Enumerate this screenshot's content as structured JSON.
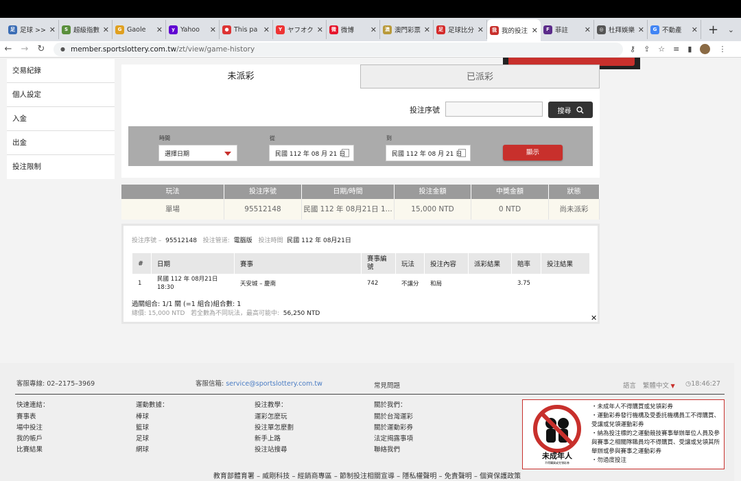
{
  "browser": {
    "tabs": [
      {
        "title": "足球 >>",
        "fav_color": "#3b6db5",
        "fav_text": "足"
      },
      {
        "title": "超級指數",
        "fav_color": "#5a8f3c",
        "fav_text": "S"
      },
      {
        "title": "Gaole",
        "fav_color": "#e0a020",
        "fav_text": "G"
      },
      {
        "title": "Yahoo",
        "fav_color": "#6001d2",
        "fav_text": "y"
      },
      {
        "title": "This pa",
        "fav_color": "#d33",
        "fav_text": "●"
      },
      {
        "title": "ヤフオク",
        "fav_color": "#e33",
        "fav_text": "Y"
      },
      {
        "title": "微博",
        "fav_color": "#e6162d",
        "fav_text": "微"
      },
      {
        "title": "澳門彩票",
        "fav_color": "#b99a3a",
        "fav_text": "澳"
      },
      {
        "title": "足球比分",
        "fav_color": "#d42a2a",
        "fav_text": "足"
      },
      {
        "title": "我的投注",
        "fav_color": "#c8302c",
        "fav_text": "我",
        "active": true
      },
      {
        "title": "菲註",
        "fav_color": "#5b2b8a",
        "fav_text": "F"
      },
      {
        "title": "杜拜娛樂",
        "fav_color": "#555",
        "fav_text": "◎"
      },
      {
        "title": "不動產",
        "fav_color": "#4285f4",
        "fav_text": "G"
      }
    ],
    "url_host": "member.sportslottery.com.tw",
    "url_path": "/zt/view/game-history"
  },
  "sidebar": {
    "items": [
      "交易紀錄",
      "個人設定",
      "入金",
      "出金",
      "投注限制"
    ]
  },
  "tabs": {
    "unsettled": "未派彩",
    "settled": "已派彩"
  },
  "search": {
    "label": "投注序號",
    "value": "",
    "button": "搜尋"
  },
  "filter": {
    "time_label": "時間",
    "time_value": "選擇日期",
    "from_label": "從",
    "from_value": "民國 112 年 08 月 21 日",
    "to_label": "到",
    "to_value": "民國 112 年 08 月 21 日",
    "show_button": "顯示"
  },
  "summary": {
    "headers": [
      "玩法",
      "投注序號",
      "日期/時間",
      "投注金額",
      "中獎金額",
      "狀態"
    ],
    "row": [
      "單場",
      "95512148",
      "民國 112 年 08月21日 1...",
      "15,000 NTD",
      "0 NTD",
      "尚未派彩"
    ]
  },
  "detail": {
    "serial_label": "投注序號 –",
    "serial": "95512148",
    "channel_label": "投注管道:",
    "channel": "電腦版",
    "time_label": "投注時間",
    "time": "民國 112 年 08月21日",
    "headers": [
      "#",
      "日期",
      "賽事",
      "賽事編號",
      "玩法",
      "投注內容",
      "派彩結果",
      "賠率",
      "投注結果"
    ],
    "row": {
      "num": "1",
      "date1": "民國 112 年 08月21日",
      "date2": "18:30",
      "match": "天安城 – 慶南",
      "code": "742",
      "play": "不讓分",
      "content": "和局",
      "result": "",
      "odds": "3.75",
      "bet_result": ""
    },
    "combo": "過關組合: 1/1 關 (=1 組合)組合數: 1",
    "total_label": "總價: 15,000 NTD",
    "total_note": "若全數為不同玩法，最高可能中:",
    "total_max": "56,250 NTD"
  },
  "footer": {
    "hotline": "客服專線: 02–2175–3969",
    "mail_label": "客服信箱:",
    "mail": "service@sportslottery.com.tw",
    "faq": "常見問題",
    "lang_label": "語言",
    "lang": "繁體中文",
    "clock": "18:46:27",
    "cols": [
      {
        "title": "快速連結：",
        "items": [
          "賽事表",
          "場中投注",
          "我的帳戶",
          "比賽結果"
        ]
      },
      {
        "title": "運動數據：",
        "items": [
          "棒球",
          "籃球",
          "足球",
          "網球"
        ]
      },
      {
        "title": "投注教學：",
        "items": [
          "運彩怎麼玩",
          "投注單怎麼劃",
          "新手上路",
          "投注站搜尋"
        ]
      },
      {
        "title": "關於我們：",
        "items": [
          "關於台灣運彩",
          "關於運動彩券",
          "法定揭露事項",
          "聯絡我們"
        ]
      }
    ],
    "warn_image_text": "未成年人",
    "warn_image_sub": "不得購買或兌領彩券",
    "warnings": [
      "・未成年人不得購買或兌領彩券",
      "・運動彩券發行機構及受委託機構員工不得購買、受讓或兌領運動彩券",
      "・納為投注標的之運動競技賽事舉辦單位人員及參與賽事之相關隊職員均不得購買、受讓或兌領其所舉辦或參與賽事之運動彩券",
      "・勿過度投注"
    ],
    "bottom": "教育部體育署 – 威剛科技 – 經銷商專區 – 節制投注相關宣導 – 隱私權聲明 – 免責聲明 – 個資保護政策"
  }
}
